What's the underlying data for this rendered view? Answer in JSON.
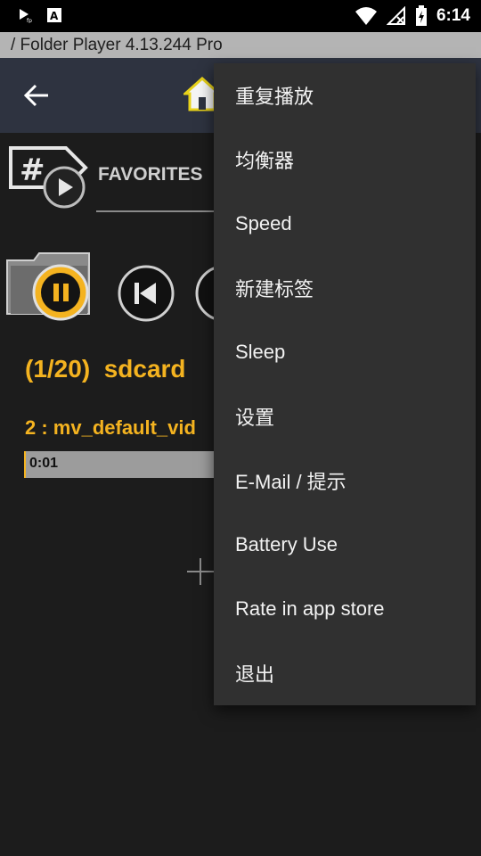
{
  "status_bar": {
    "time": "6:14",
    "icons": [
      "play-notification-icon",
      "a-notification-icon",
      "wifi-icon",
      "no-signal-icon",
      "battery-charging-icon"
    ]
  },
  "title_strip": {
    "text": "/ Folder Player 4.13.244  Pro"
  },
  "toolbar": {
    "icons": [
      "back-arrow-icon",
      "home-icon"
    ]
  },
  "favorites": {
    "label": "FAVORITES",
    "icon": "tag-play-icon"
  },
  "player": {
    "folder_count": "(1/20)  sdcard",
    "track_title": "2 : mv_default_vid",
    "elapsed": "0:01",
    "state_icon": "pause-icon"
  },
  "menu": {
    "items": [
      "重复播放",
      "均衡器",
      "Speed",
      "新建标签",
      "Sleep",
      "设置",
      "E-Mail / 提示",
      "Battery Use",
      "Rate in app store",
      "退出"
    ]
  },
  "colors": {
    "accent": "#f4b320",
    "toolbar": "#2e3340",
    "menu_bg": "#303030",
    "background": "#1c1c1c"
  }
}
